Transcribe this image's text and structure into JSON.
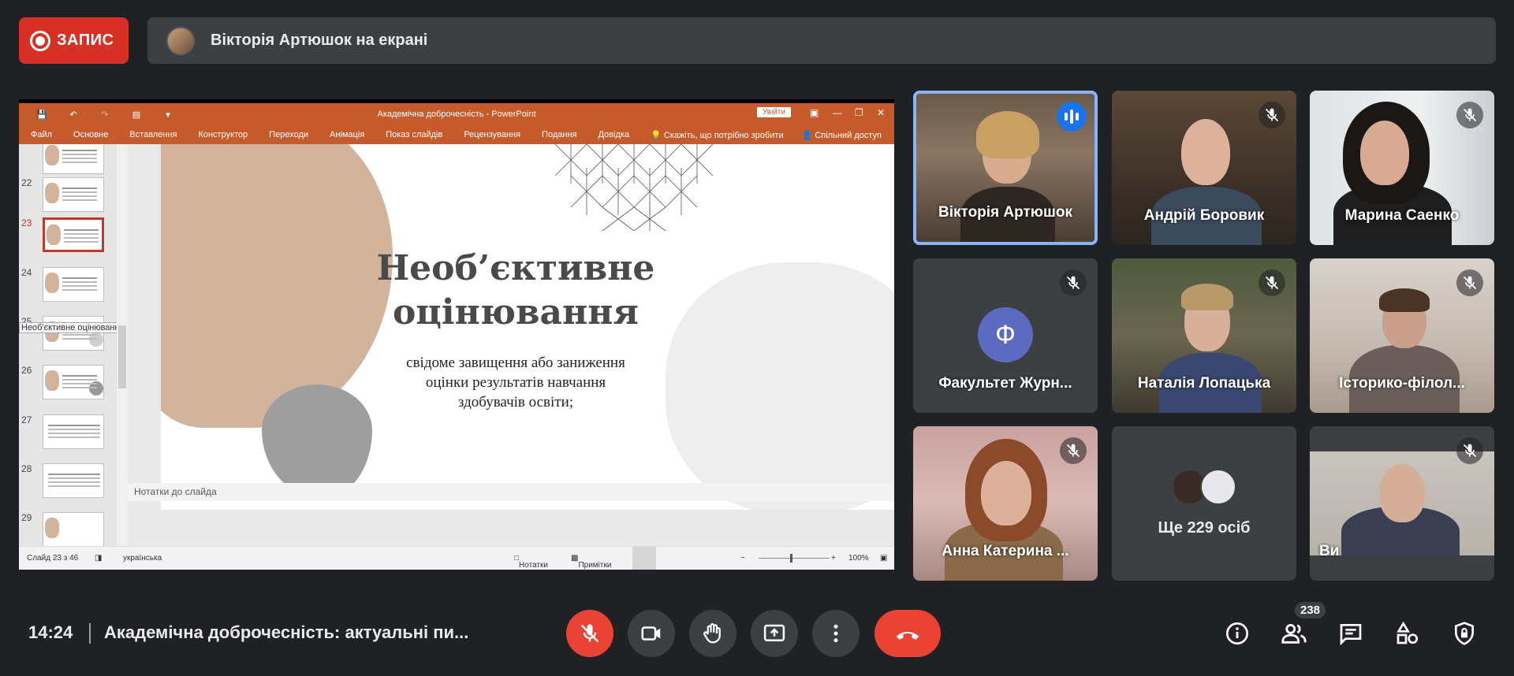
{
  "recording": {
    "label": "ЗАПИС"
  },
  "presenter_bar": {
    "text": "Вікторія Артюшок на екрані"
  },
  "ppt": {
    "window_title": "Академічна доброчесність  -  PowerPoint",
    "sign_in": "Увійти",
    "ribbon_tabs": [
      "Файл",
      "Основне",
      "Вставлення",
      "Конструктор",
      "Переходи",
      "Анімація",
      "Показ слайдів",
      "Рецензування",
      "Подання",
      "Довідка"
    ],
    "tell_me": "Скажіть, що потрібно зробити",
    "share": "Спільний доступ",
    "thumb_numbers": [
      "22",
      "23",
      "24",
      "25",
      "26",
      "27",
      "28",
      "29"
    ],
    "active_thumb": "23",
    "thumb_tooltip": "Необ'єктивне оцінювання",
    "slide": {
      "title_line1": "Необ’єктивне",
      "title_line2": "оцінювання",
      "body_line1": "свідоме завищення або заниження",
      "body_line2": "оцінки результатів навчання",
      "body_line3": "здобувачів освіти;"
    },
    "notes_placeholder": "Нотатки до слайда",
    "status": {
      "slide_count": "Слайд 23 з 46",
      "language": "українська",
      "notes_btn": "Нотатки",
      "comments_btn": "Примітки",
      "zoom": "100%"
    }
  },
  "participants": [
    {
      "name": "Вікторія Артюшок",
      "speaking": true
    },
    {
      "name": "Андрій Боровик",
      "muted": true
    },
    {
      "name": "Марина Саенко",
      "muted": true
    },
    {
      "name": "Факультет Журн...",
      "muted": true,
      "initial": "Ф",
      "avatar_color": "#5c6bc0"
    },
    {
      "name": "Наталія Лопацька",
      "muted": true
    },
    {
      "name": "Історико-філол...",
      "muted": true
    },
    {
      "name": "Анна Катерина ...",
      "muted": true
    },
    {
      "name": "Ще 229 осіб"
    },
    {
      "name": "Ви",
      "muted": true
    }
  ],
  "bottom": {
    "time": "14:24",
    "meeting_title": "Академічна доброчесність: актуальні пи...",
    "people_count": "238"
  },
  "colors": {
    "accent_red": "#ea4335",
    "record_red": "#d93025",
    "bg": "#202124",
    "tile": "#3c4043",
    "ppt_orange": "#c55a2b",
    "speaking_blue": "#8ab4f8"
  }
}
